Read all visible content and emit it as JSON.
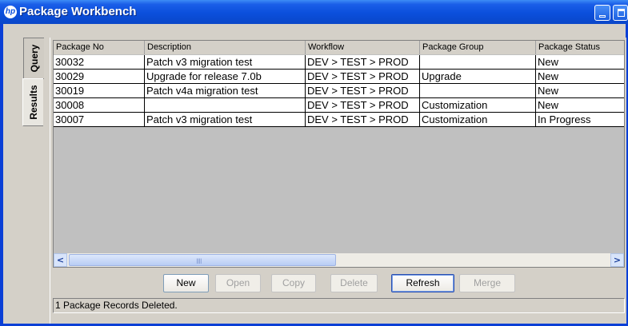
{
  "window": {
    "title": "Package Workbench",
    "logo_text": "hp"
  },
  "tabs": {
    "query": "Query",
    "results": "Results"
  },
  "table": {
    "columns": [
      "Package No",
      "Description",
      "Workflow",
      "Package Group",
      "Package Status"
    ],
    "rows": [
      [
        "30032",
        "Patch v3 migration test",
        "DEV > TEST > PROD",
        "",
        "New"
      ],
      [
        "30029",
        "Upgrade for release 7.0b",
        "DEV > TEST > PROD",
        "Upgrade",
        "New"
      ],
      [
        "30019",
        "Patch v4a migration test",
        "DEV > TEST > PROD",
        "",
        "New"
      ],
      [
        "30008",
        "",
        "DEV > TEST > PROD",
        "Customization",
        "New"
      ],
      [
        "30007",
        "Patch v3 migration test",
        "DEV > TEST > PROD",
        "Customization",
        "In Progress"
      ]
    ]
  },
  "scrollbar": {
    "left_arrow": "<",
    "right_arrow": ">",
    "grip": "IIII"
  },
  "buttons": {
    "new": "New",
    "open": "Open",
    "copy": "Copy",
    "delete": "Delete",
    "refresh": "Refresh",
    "merge": "Merge"
  },
  "status": "1 Package Records Deleted.",
  "colors": {
    "title_bar": "#0b4fdc",
    "client": "#d4d0c8",
    "grid_empty": "#c0c0c0"
  }
}
